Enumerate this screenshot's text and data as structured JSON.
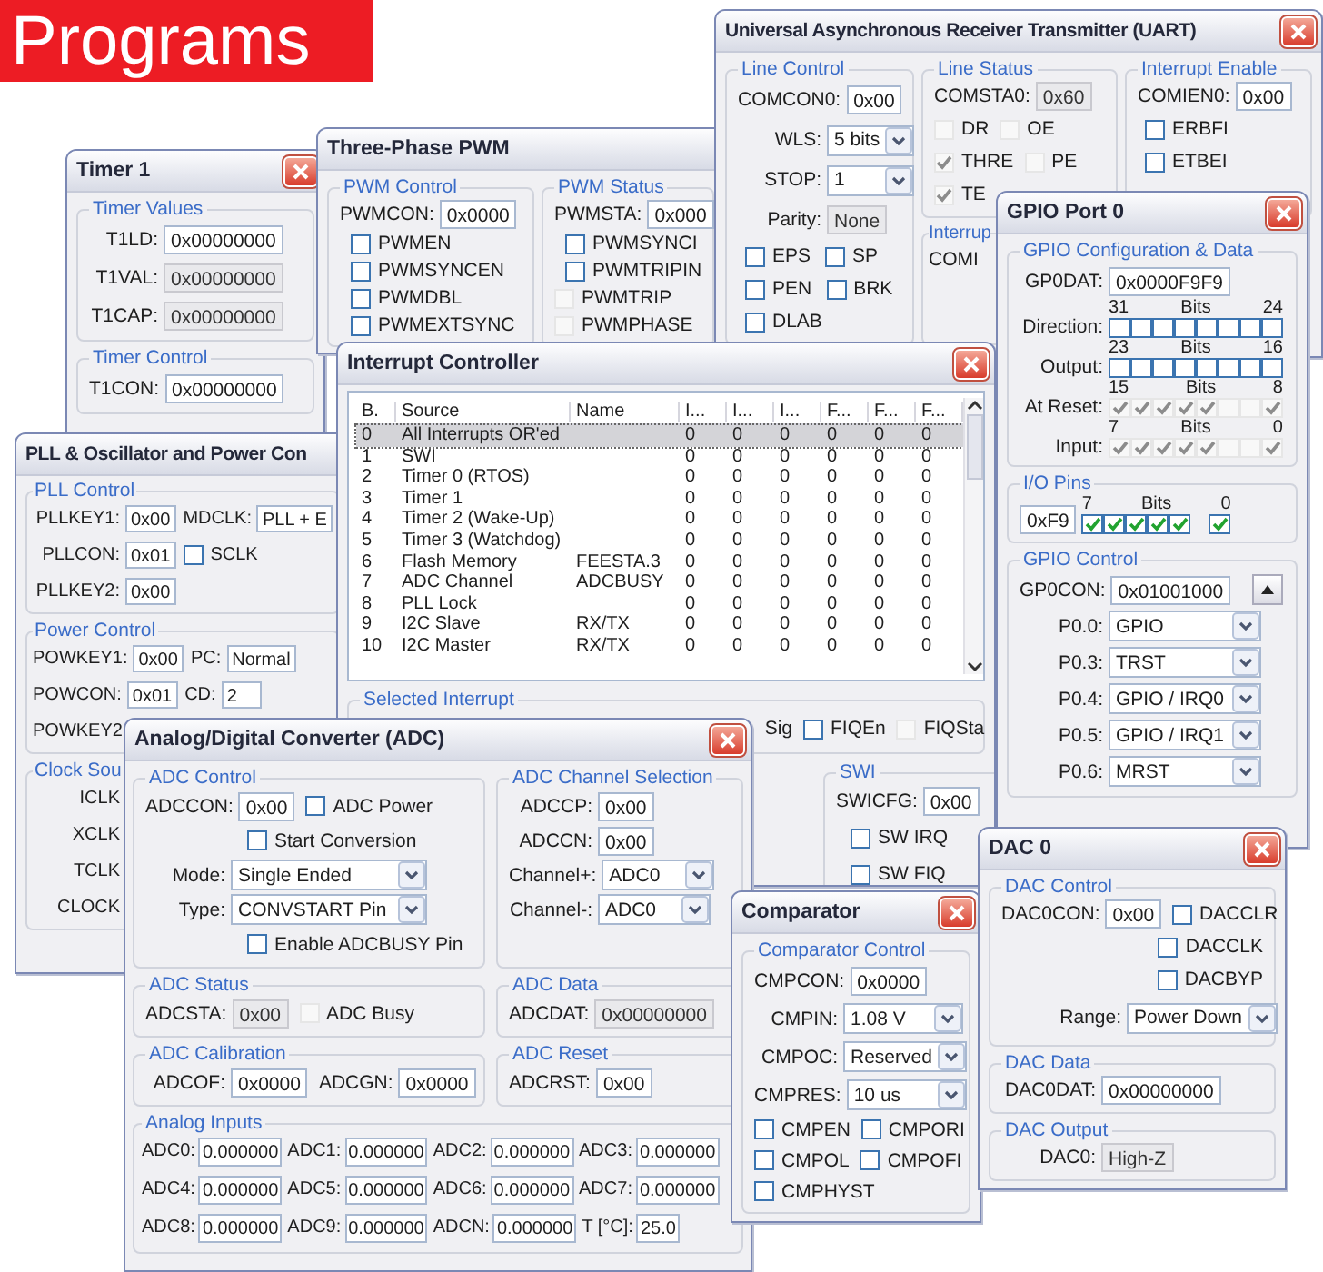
{
  "banner": {
    "title": "Programs"
  },
  "windows": [
    {
      "kind": "timer",
      "title": "Timer 1",
      "close_button": true,
      "groups": [
        {
          "legend": "Timer Values",
          "rows": [
            [
              {
                "kind": "field",
                "label": "T1LD:",
                "value": "0x00000000"
              }
            ],
            [
              {
                "kind": "readout",
                "label": "T1VAL:",
                "value": "0x00000000"
              }
            ],
            [
              {
                "kind": "readout",
                "label": "T1CAP:",
                "value": "0x00000000"
              }
            ]
          ]
        },
        {
          "legend": "Timer Control",
          "rows": [
            [
              {
                "kind": "field",
                "label": "T1CON:",
                "value": "0x00000000"
              }
            ]
          ]
        }
      ]
    },
    {
      "kind": "pwm",
      "title": "Three-Phase PWM",
      "close_button": false,
      "groups": [
        {
          "legend": "PWM Control",
          "rows": [
            [
              {
                "kind": "field",
                "label": "PWMCON:",
                "value": "0x0000"
              }
            ],
            [
              {
                "kind": "check",
                "label": "PWMEN",
                "checked": false
              }
            ],
            [
              {
                "kind": "check",
                "label": "PWMSYNCEN",
                "checked": false
              }
            ],
            [
              {
                "kind": "check",
                "label": "PWMDBL",
                "checked": false
              }
            ],
            [
              {
                "kind": "check",
                "label": "PWMEXTSYNC",
                "checked": false
              }
            ]
          ]
        },
        {
          "legend": "PWM Status",
          "rows": [
            [
              {
                "kind": "field",
                "label": "PWMSTA:",
                "value": "0x000"
              }
            ],
            [
              {
                "kind": "check",
                "label": "PWMSYNCI",
                "checked": false
              }
            ],
            [
              {
                "kind": "check",
                "label": "PWMTRIPIN",
                "checked": false
              }
            ],
            [
              {
                "kind": "status",
                "label": "PWMTRIP",
                "checked": false
              }
            ],
            [
              {
                "kind": "status",
                "label": "PWMPHASE",
                "checked": false
              }
            ]
          ]
        }
      ]
    },
    {
      "kind": "uart",
      "title": "Universal Asynchronous Receiver Transmitter (UART)",
      "close_button": true,
      "groups": [
        {
          "legend": "Line Control",
          "rows": [
            [
              {
                "kind": "field",
                "label": "COMCON0:",
                "value": "0x00"
              }
            ],
            [
              {
                "kind": "select",
                "label": "WLS:",
                "value": "5 bits"
              }
            ],
            [
              {
                "kind": "select",
                "label": "STOP:",
                "value": "1"
              }
            ],
            [
              {
                "kind": "readout",
                "label": "Parity:",
                "value": "None"
              }
            ],
            [
              {
                "kind": "check",
                "label": "EPS",
                "checked": false
              },
              {
                "kind": "check",
                "label": "SP",
                "checked": false
              }
            ],
            [
              {
                "kind": "check",
                "label": "PEN",
                "checked": false
              },
              {
                "kind": "check",
                "label": "BRK",
                "checked": false
              }
            ],
            [
              {
                "kind": "check",
                "label": "DLAB",
                "checked": false
              }
            ]
          ]
        },
        {
          "legend": "Line Status",
          "rows": [
            [
              {
                "kind": "readout",
                "label": "COMSTA0:",
                "value": "0x60"
              }
            ],
            [
              {
                "kind": "status",
                "label": "DR",
                "checked": false
              },
              {
                "kind": "status",
                "label": "OE",
                "checked": false
              }
            ],
            [
              {
                "kind": "status",
                "label": "THRE",
                "checked": true
              },
              {
                "kind": "status",
                "label": "PE",
                "checked": false
              }
            ],
            [
              {
                "kind": "status",
                "label": "TE",
                "checked": true
              }
            ]
          ]
        },
        {
          "legend": "Interrupt Enable",
          "rows": [
            [
              {
                "kind": "field",
                "label": "COMIEN0:",
                "value": "0x00"
              }
            ],
            [
              {
                "kind": "check",
                "label": "ERBFI",
                "checked": false
              }
            ],
            [
              {
                "kind": "check",
                "label": "ETBEI",
                "checked": false
              }
            ]
          ]
        },
        {
          "legend": "Interrup",
          "rows": [
            [
              {
                "kind": "text",
                "label": "COMI"
              }
            ]
          ]
        }
      ]
    },
    {
      "kind": "pll",
      "title": "PLL & Oscillator and Power Con",
      "close_button": false,
      "groups": [
        {
          "legend": "PLL Control",
          "rows": [
            [
              {
                "kind": "field",
                "label": "PLLKEY1:",
                "value": "0x00"
              },
              {
                "kind": "field",
                "label": "MDCLK:",
                "value": "PLL + E"
              }
            ],
            [
              {
                "kind": "field",
                "label": "PLLCON:",
                "value": "0x01"
              },
              {
                "kind": "check",
                "label": "SCLK",
                "checked": false
              }
            ],
            [
              {
                "kind": "field",
                "label": "PLLKEY2:",
                "value": "0x00"
              }
            ]
          ]
        },
        {
          "legend": "Power Control",
          "rows": [
            [
              {
                "kind": "field",
                "label": "POWKEY1:",
                "value": "0x00"
              },
              {
                "kind": "field",
                "label": "PC:",
                "value": "Normal"
              }
            ],
            [
              {
                "kind": "field",
                "label": "POWCON:",
                "value": "0x01"
              },
              {
                "kind": "field",
                "label": "CD:",
                "value": "2"
              }
            ],
            [
              {
                "kind": "text",
                "label": "POWKEY2"
              }
            ]
          ]
        },
        {
          "legend": "Clock Sou",
          "rows": [
            [
              {
                "kind": "text",
                "label": "ICLK"
              }
            ],
            [
              {
                "kind": "text",
                "label": "XCLK"
              }
            ],
            [
              {
                "kind": "text",
                "label": "TCLK"
              }
            ],
            [
              {
                "kind": "text",
                "label": "CLOCK"
              }
            ]
          ]
        }
      ]
    },
    {
      "kind": "intc",
      "title": "Interrupt Controller",
      "close_button": true,
      "table": {
        "columns": [
          "B.",
          "Source",
          "Name",
          "I...",
          "I...",
          "I...",
          "F...",
          "F...",
          "F..."
        ],
        "rows": [
          {
            "bit": "0",
            "source": "All Interrupts OR'ed",
            "values": [
              "0",
              "0",
              "0",
              "0",
              "0",
              "0"
            ],
            "selected": true
          },
          {
            "bit": "1",
            "source": "SWI",
            "values": [
              "0",
              "0",
              "0",
              "0",
              "0",
              "0"
            ],
            "selected": false
          },
          {
            "bit": "2",
            "source": "Timer 0 (RTOS)",
            "values": [
              "0",
              "0",
              "0",
              "0",
              "0",
              "0"
            ],
            "selected": false
          },
          {
            "bit": "3",
            "source": "Timer 1",
            "values": [
              "0",
              "0",
              "0",
              "0",
              "0",
              "0"
            ],
            "selected": false
          },
          {
            "bit": "4",
            "source": "Timer 2 (Wake-Up)",
            "values": [
              "0",
              "0",
              "0",
              "0",
              "0",
              "0"
            ],
            "selected": false
          },
          {
            "bit": "5",
            "source": "Timer 3 (Watchdog)",
            "values": [
              "0",
              "0",
              "0",
              "0",
              "0",
              "0"
            ],
            "selected": false
          },
          {
            "bit": "6",
            "source": "Flash Memory",
            "name": "FEESTA.3",
            "values": [
              "0",
              "0",
              "0",
              "0",
              "0",
              "0"
            ],
            "selected": false
          },
          {
            "bit": "7",
            "source": "ADC Channel",
            "name": "ADCBUSY",
            "values": [
              "0",
              "0",
              "0",
              "0",
              "0",
              "0"
            ],
            "selected": false
          },
          {
            "bit": "8",
            "source": "PLL Lock",
            "values": [
              "0",
              "0",
              "0",
              "0",
              "0",
              "0"
            ],
            "selected": false
          },
          {
            "bit": "9",
            "source": "I2C Slave",
            "name": "RX/TX",
            "values": [
              "0",
              "0",
              "0",
              "0",
              "0",
              "0"
            ],
            "selected": false
          },
          {
            "bit": "10",
            "source": "I2C Master",
            "name": "RX/TX",
            "values": [
              "0",
              "0",
              "0",
              "0",
              "0",
              "0"
            ],
            "selected": false
          }
        ]
      },
      "groups": [
        {
          "legend": "Selected Interrupt",
          "rows": [
            [
              {
                "kind": "text",
                "label": "Sig"
              },
              {
                "kind": "check",
                "label": "FIQEn",
                "checked": false
              },
              {
                "kind": "status",
                "label": "FIQSta",
                "checked": false
              }
            ]
          ]
        },
        {
          "legend": "SWI",
          "rows": [
            [
              {
                "kind": "field",
                "label": "SWICFG:",
                "value": "0x00"
              }
            ],
            [
              {
                "kind": "check",
                "label": "SW IRQ",
                "checked": false
              }
            ],
            [
              {
                "kind": "check",
                "label": "SW FIQ",
                "checked": false
              }
            ]
          ]
        }
      ]
    },
    {
      "kind": "gpio",
      "title": "GPIO Port 0",
      "close_button": true,
      "groups": [
        {
          "legend": "GPIO Configuration & Data",
          "rows": [
            [
              {
                "kind": "field",
                "label": "GP0DAT:",
                "value": "0x0000F9F9"
              }
            ],
            [
              {
                "kind": "bits",
                "label": "Direction:",
                "hi": "31",
                "mid": "Bits",
                "lo": "24",
                "bits": [
                  {
                    "checked": false
                  },
                  {
                    "checked": false
                  },
                  {
                    "checked": false
                  },
                  {
                    "checked": false
                  },
                  {
                    "checked": false
                  },
                  {
                    "checked": false
                  },
                  {
                    "checked": false
                  },
                  {
                    "checked": false
                  }
                ]
              }
            ],
            [
              {
                "kind": "bits",
                "label": "Output:",
                "hi": "23",
                "mid": "Bits",
                "lo": "16",
                "bits": [
                  {
                    "checked": false
                  },
                  {
                    "checked": false
                  },
                  {
                    "checked": false
                  },
                  {
                    "checked": false
                  },
                  {
                    "checked": false
                  },
                  {
                    "checked": false
                  },
                  {
                    "checked": false
                  },
                  {
                    "checked": false
                  }
                ]
              }
            ],
            [
              {
                "kind": "statusbits",
                "label": "At Reset:",
                "hi": "15",
                "mid": "Bits",
                "lo": "8",
                "bits": [
                  {
                    "checked": true
                  },
                  {
                    "checked": true
                  },
                  {
                    "checked": true
                  },
                  {
                    "checked": true
                  },
                  {
                    "checked": true
                  },
                  {
                    "checked": false
                  },
                  {
                    "checked": false
                  },
                  {
                    "checked": true
                  }
                ]
              }
            ],
            [
              {
                "kind": "statusbits",
                "label": "Input:",
                "hi": "7",
                "mid": "Bits",
                "lo": "0",
                "bits": [
                  {
                    "checked": true
                  },
                  {
                    "checked": true
                  },
                  {
                    "checked": true
                  },
                  {
                    "checked": true
                  },
                  {
                    "checked": true
                  },
                  {
                    "checked": false
                  },
                  {
                    "checked": false
                  },
                  {
                    "checked": true
                  }
                ]
              }
            ]
          ]
        },
        {
          "legend": "I/O Pins",
          "rows": [
            [
              {
                "kind": "pins",
                "value": "0xF9",
                "hi": "7",
                "mid": "Bits",
                "lo": "0",
                "bits": [
                  {
                    "checked": true
                  },
                  {
                    "checked": true
                  },
                  {
                    "checked": true
                  },
                  {
                    "checked": true
                  },
                  {
                    "checked": true
                  },
                  {
                    "checked": true
                  }
                ]
              }
            ]
          ]
        },
        {
          "legend": "GPIO Control",
          "rows": [
            [
              {
                "kind": "field",
                "label": "GP0CON:",
                "value": "0x01001000"
              },
              {
                "kind": "up_button"
              }
            ],
            [
              {
                "kind": "select",
                "label": "P0.0:",
                "value": "GPIO"
              }
            ],
            [
              {
                "kind": "select",
                "label": "P0.3:",
                "value": "TRST"
              }
            ],
            [
              {
                "kind": "select",
                "label": "P0.4:",
                "value": "GPIO / IRQ0"
              }
            ],
            [
              {
                "kind": "select",
                "label": "P0.5:",
                "value": "GPIO / IRQ1"
              }
            ],
            [
              {
                "kind": "select",
                "label": "P0.6:",
                "value": "MRST"
              }
            ]
          ]
        }
      ]
    },
    {
      "kind": "adc",
      "title": "Analog/Digital Converter (ADC)",
      "close_button": true,
      "groups": [
        {
          "legend": "ADC Control",
          "rows": [
            [
              {
                "kind": "field",
                "label": "ADCCON:",
                "value": "0x00"
              },
              {
                "kind": "check",
                "label": "ADC Power",
                "checked": false
              }
            ],
            [
              {
                "kind": "check",
                "label": "Start Conversion",
                "checked": false
              }
            ],
            [
              {
                "kind": "select",
                "label": "Mode:",
                "value": "Single Ended"
              }
            ],
            [
              {
                "kind": "select",
                "label": "Type:",
                "value": "CONVSTART Pin"
              }
            ],
            [
              {
                "kind": "check",
                "label": "Enable ADCBUSY Pin",
                "checked": false
              }
            ]
          ]
        },
        {
          "legend": "ADC Channel Selection",
          "rows": [
            [
              {
                "kind": "field",
                "label": "ADCCP:",
                "value": "0x00"
              }
            ],
            [
              {
                "kind": "field",
                "label": "ADCCN:",
                "value": "0x00"
              }
            ],
            [
              {
                "kind": "select",
                "label": "Channel+:",
                "value": "ADC0"
              }
            ],
            [
              {
                "kind": "select",
                "label": "Channel-:",
                "value": "ADC0"
              }
            ]
          ]
        },
        {
          "legend": "ADC Status",
          "rows": [
            [
              {
                "kind": "readout",
                "label": "ADCSTA:",
                "value": "0x00"
              },
              {
                "kind": "status",
                "label": "ADC Busy",
                "checked": false
              }
            ]
          ]
        },
        {
          "legend": "ADC Data",
          "rows": [
            [
              {
                "kind": "readout",
                "label": "ADCDAT:",
                "value": "0x00000000"
              }
            ]
          ]
        },
        {
          "legend": "ADC Calibration",
          "rows": [
            [
              {
                "kind": "field",
                "label": "ADCOF:",
                "value": "0x0000"
              },
              {
                "kind": "field",
                "label": "ADCGN:",
                "value": "0x0000"
              }
            ]
          ]
        },
        {
          "legend": "ADC Reset",
          "rows": [
            [
              {
                "kind": "field",
                "label": "ADCRST:",
                "value": "0x00"
              }
            ]
          ]
        },
        {
          "legend": "Analog Inputs",
          "rows": [
            [
              {
                "kind": "field",
                "label": "ADC0:",
                "value": "0.000000"
              },
              {
                "kind": "field",
                "label": "ADC1:",
                "value": "0.000000"
              },
              {
                "kind": "field",
                "label": "ADC2:",
                "value": "0.000000"
              },
              {
                "kind": "field",
                "label": "ADC3:",
                "value": "0.000000"
              }
            ],
            [
              {
                "kind": "field",
                "label": "ADC4:",
                "value": "0.000000"
              },
              {
                "kind": "field",
                "label": "ADC5:",
                "value": "0.000000"
              },
              {
                "kind": "field",
                "label": "ADC6:",
                "value": "0.000000"
              },
              {
                "kind": "field",
                "label": "ADC7:",
                "value": "0.000000"
              }
            ],
            [
              {
                "kind": "field",
                "label": "ADC8:",
                "value": "0.000000"
              },
              {
                "kind": "field",
                "label": "ADC9:",
                "value": "0.000000"
              },
              {
                "kind": "field",
                "label": "ADCN:",
                "value": "0.000000"
              },
              {
                "kind": "field",
                "label": "T [°C]:",
                "value": "25.0"
              }
            ]
          ]
        }
      ]
    },
    {
      "kind": "comparator",
      "title": "Comparator",
      "close_button": true,
      "groups": [
        {
          "legend": "Comparator Control",
          "rows": [
            [
              {
                "kind": "field",
                "label": "CMPCON:",
                "value": "0x0000"
              }
            ],
            [
              {
                "kind": "select",
                "label": "CMPIN:",
                "value": "1.08 V"
              }
            ],
            [
              {
                "kind": "select",
                "label": "CMPOC:",
                "value": "Reserved"
              }
            ],
            [
              {
                "kind": "select",
                "label": "CMPRES:",
                "value": "10 us"
              }
            ],
            [
              {
                "kind": "check",
                "label": "CMPEN",
                "checked": false
              },
              {
                "kind": "check",
                "label": "CMPORI",
                "checked": false
              }
            ],
            [
              {
                "kind": "check",
                "label": "CMPOL",
                "checked": false
              },
              {
                "kind": "check",
                "label": "CMPOFI",
                "checked": false
              }
            ],
            [
              {
                "kind": "check",
                "label": "CMPHYST",
                "checked": false
              }
            ]
          ]
        }
      ]
    },
    {
      "kind": "dac",
      "title": "DAC 0",
      "close_button": true,
      "groups": [
        {
          "legend": "DAC Control",
          "rows": [
            [
              {
                "kind": "field",
                "label": "DAC0CON:",
                "value": "0x00"
              },
              {
                "kind": "check",
                "label": "DACCLR",
                "checked": false
              }
            ],
            [
              {
                "kind": "check",
                "label": "DACCLK",
                "checked": false
              }
            ],
            [
              {
                "kind": "check",
                "label": "DACBYP",
                "checked": false
              }
            ],
            [
              {
                "kind": "select",
                "label": "Range:",
                "value": "Power Down"
              }
            ]
          ]
        },
        {
          "legend": "DAC Data",
          "rows": [
            [
              {
                "kind": "field",
                "label": "DAC0DAT:",
                "value": "0x00000000"
              }
            ]
          ]
        },
        {
          "legend": "DAC Output",
          "rows": [
            [
              {
                "kind": "readout",
                "label": "DAC0:",
                "value": "High-Z"
              }
            ]
          ]
        }
      ]
    }
  ]
}
